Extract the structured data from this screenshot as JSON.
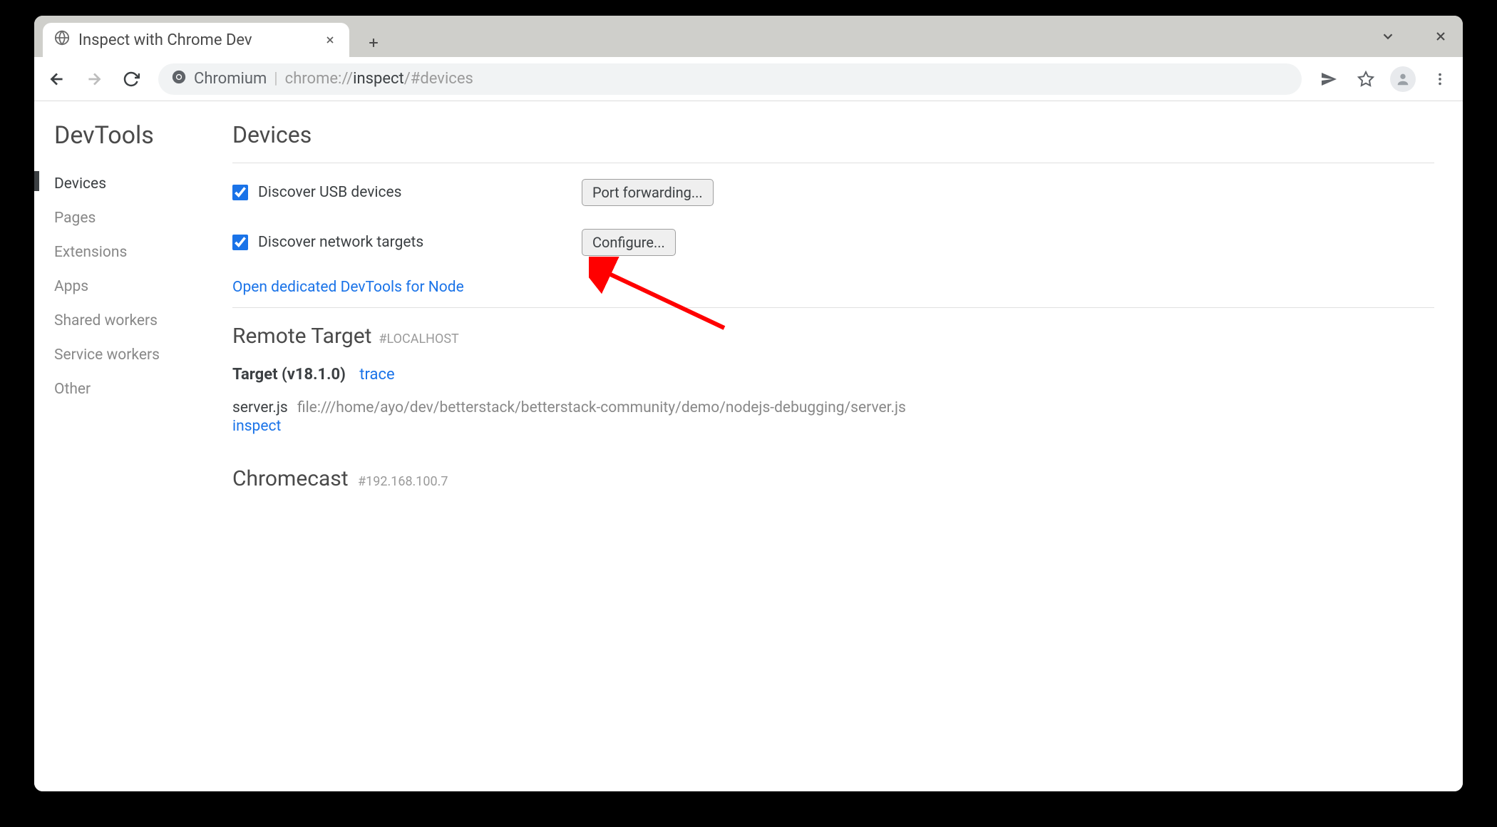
{
  "tab": {
    "title": "Inspect with Chrome Dev"
  },
  "omnibox": {
    "app": "Chromium",
    "url_prefix": "chrome://",
    "url_strong": "inspect",
    "url_suffix": "/#devices"
  },
  "sidebar": {
    "title": "DevTools",
    "items": [
      "Devices",
      "Pages",
      "Extensions",
      "Apps",
      "Shared workers",
      "Service workers",
      "Other"
    ]
  },
  "main": {
    "title": "Devices",
    "usb_label": "Discover USB devices",
    "port_forward_btn": "Port forwarding...",
    "net_label": "Discover network targets",
    "configure_btn": "Configure...",
    "open_devtools_link": "Open dedicated DevTools for Node",
    "remote": {
      "title": "Remote Target",
      "hash": "#LOCALHOST"
    },
    "target": {
      "label": "Target (v18.1.0)",
      "trace": "trace",
      "file_name": "server.js",
      "file_path": "file:///home/ayo/dev/betterstack/betterstack-community/demo/nodejs-debugging/server.js",
      "inspect": "inspect"
    },
    "cast": {
      "title": "Chromecast",
      "hash": "#192.168.100.7"
    }
  }
}
